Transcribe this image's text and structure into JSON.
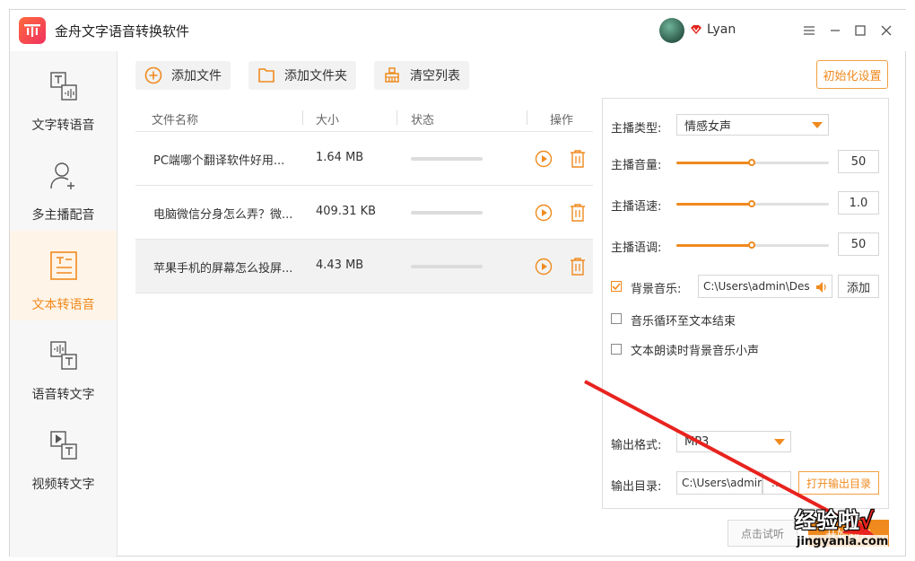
{
  "window": {
    "title": "金舟文字语音转换软件",
    "user_name": "Lyan"
  },
  "sidebar": {
    "items": [
      {
        "label": "文字转语音"
      },
      {
        "label": "多主播配音"
      },
      {
        "label": "文本转语音"
      },
      {
        "label": "语音转文字"
      },
      {
        "label": "视频转文字"
      }
    ]
  },
  "toolbar": {
    "add_file": "添加文件",
    "add_folder": "添加文件夹",
    "clear_list": "清空列表",
    "init_settings": "初始化设置"
  },
  "table": {
    "headers": {
      "name": "文件名称",
      "size": "大小",
      "status": "状态",
      "action": "操作"
    },
    "rows": [
      {
        "name": "PC端哪个翻译软件好用...",
        "size": "1.64 MB",
        "progress": 0
      },
      {
        "name": "电脑微信分身怎么弄？微...",
        "size": "409.31 KB",
        "progress": 0
      },
      {
        "name": "苹果手机的屏幕怎么投屏...",
        "size": "4.43 MB",
        "progress": 0
      }
    ]
  },
  "settings": {
    "anchor_type_label": "主播类型:",
    "anchor_type_value": "情感女声",
    "volume_label": "主播音量:",
    "volume_value": "50",
    "speed_label": "主播语速:",
    "speed_value": "1.0",
    "pitch_label": "主播语调:",
    "pitch_value": "50",
    "bgm_label": "背景音乐:",
    "bgm_checked": true,
    "bgm_path": "C:\\Users\\admin\\Des",
    "bgm_add": "添加",
    "loop_label": "音乐循环至文本结束",
    "loop_checked": false,
    "duck_label": "文本朗读时背景音乐小声",
    "duck_checked": false,
    "format_label": "输出格式:",
    "format_value": "MP3",
    "dir_label": "输出目录:",
    "dir_value": "C:\\Users\\admir",
    "dir_more": "...",
    "open_dir": "打开输出目录"
  },
  "bottom": {
    "try_listen": "点击试听",
    "start": "开始转换"
  },
  "watermark": {
    "text": "经验啦",
    "check": "√",
    "url": "jingyanla.com"
  },
  "colors": {
    "accent": "#f08a1e",
    "brand_gradient_start": "#ff6a3d",
    "brand_gradient_end": "#f0325e",
    "arrow": "#e8231e"
  }
}
